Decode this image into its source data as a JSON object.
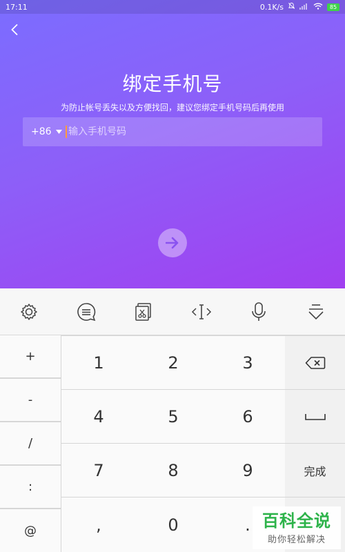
{
  "status_bar": {
    "time": "17:11",
    "speed": "0.1K/s",
    "battery": "85"
  },
  "header": {
    "title": "绑定手机号",
    "subtitle": "为防止帐号丢失以及方便找回，建议您绑定手机号码后再使用"
  },
  "phone": {
    "country_code": "+86",
    "placeholder": "输入手机号码",
    "value": ""
  },
  "keyboard": {
    "toolbar": [
      "settings-icon",
      "emoji-chat-icon",
      "clipboard-icon",
      "cursor-move-icon",
      "microphone-icon",
      "hide-keyboard-icon"
    ],
    "symbols": [
      "+",
      "-",
      "/",
      ":",
      "@"
    ],
    "digits": [
      "1",
      "2",
      "3",
      "4",
      "5",
      "6",
      "7",
      "8",
      "9",
      ",",
      "0",
      "."
    ],
    "done_label": "完成"
  },
  "watermark": {
    "top": "百科全说",
    "bottom": "助你轻松解决"
  }
}
